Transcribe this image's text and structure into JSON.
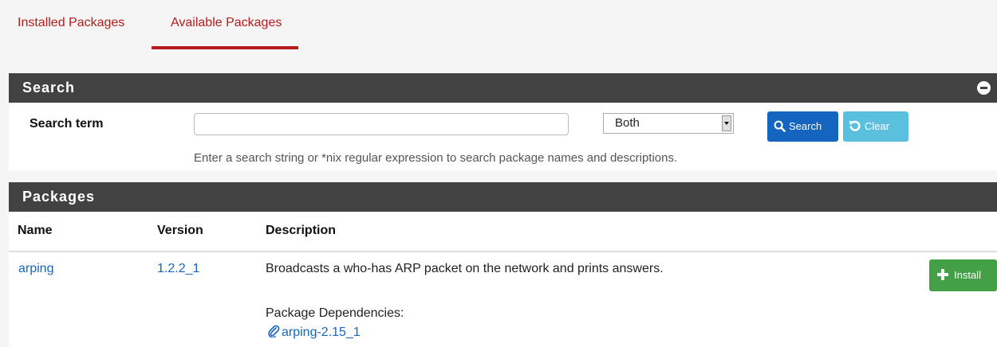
{
  "tabs": [
    {
      "label": "Installed Packages",
      "active": false
    },
    {
      "label": "Available Packages",
      "active": true
    }
  ],
  "search_panel": {
    "title": "Search",
    "label": "Search term",
    "input_value": "",
    "select_value": "Both",
    "search_button": "Search",
    "clear_button": "Clear",
    "help": "Enter a search string or *nix regular expression to search package names and descriptions."
  },
  "packages_panel": {
    "title": "Packages",
    "columns": [
      "Name",
      "Version",
      "Description"
    ],
    "rows": [
      {
        "name": "arping",
        "version": "1.2.2_1",
        "description": "Broadcasts a who-has ARP packet on the network and prints answers.",
        "deps_label": "Package Dependencies:",
        "dependency": "arping-2.15_1",
        "install_label": "Install"
      }
    ]
  },
  "colors": {
    "accent_red": "#b71c1c",
    "panel_header": "#424242",
    "link_blue": "#1565c0",
    "search_button": "#1565c0",
    "clear_button": "#5bc0de",
    "install_button": "#43a047"
  },
  "icons": [
    "minus-circle-icon",
    "search-icon",
    "undo-icon",
    "plus-icon",
    "paperclip-icon"
  ]
}
